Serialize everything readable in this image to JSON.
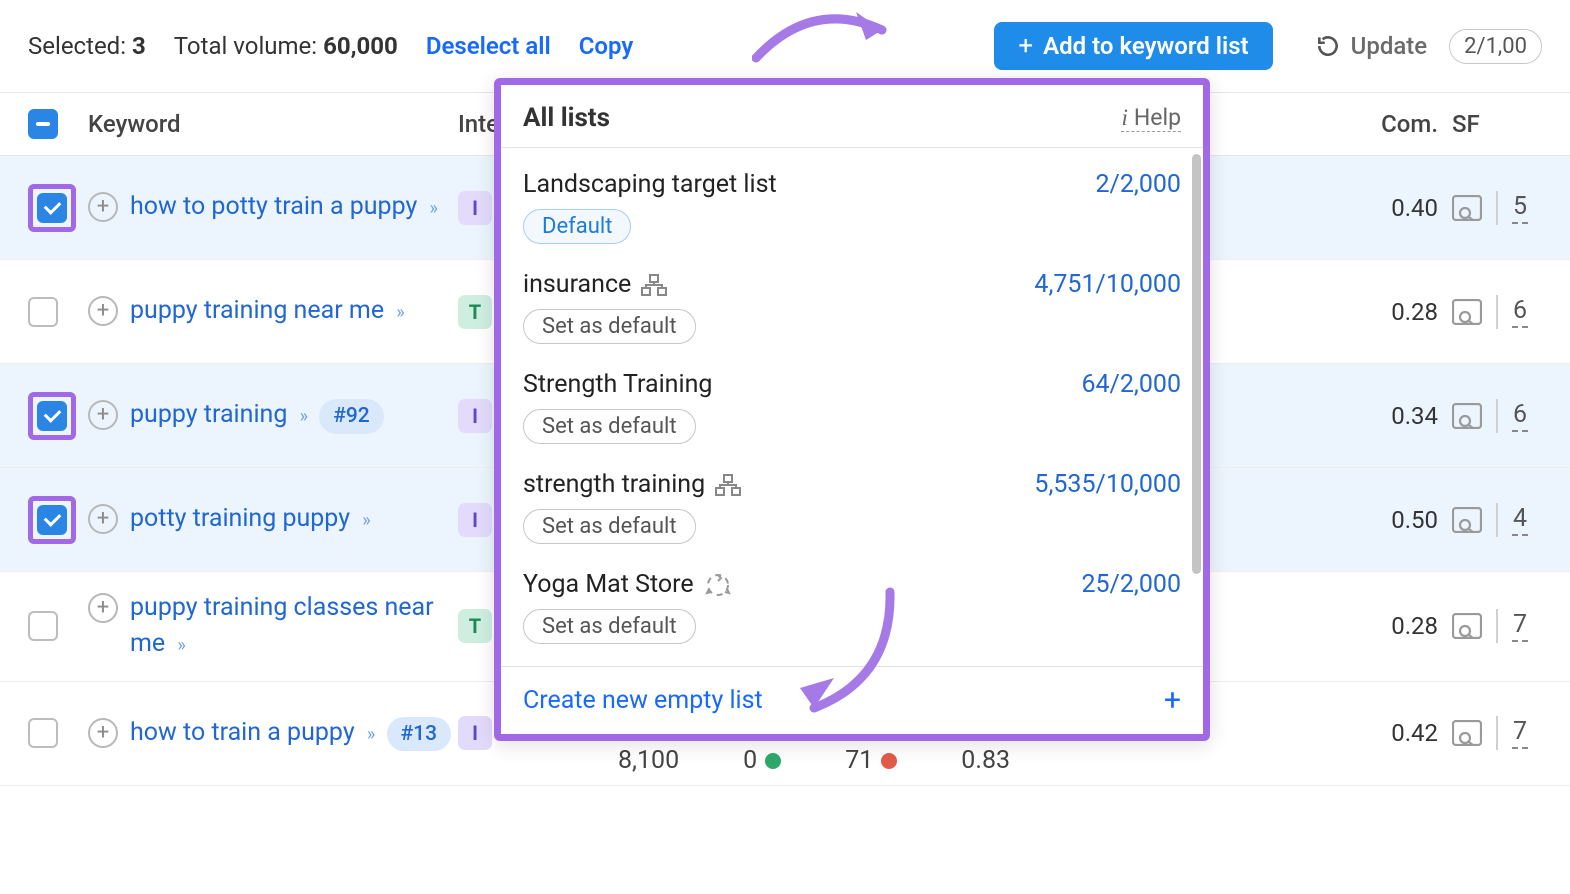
{
  "toolbar": {
    "selected_label": "Selected:",
    "selected_count": "3",
    "total_volume_label": "Total volume:",
    "total_volume": "60,000",
    "deselect": "Deselect all",
    "copy": "Copy",
    "add_to_list": "Add to keyword list",
    "update": "Update",
    "update_count": "2/1,00"
  },
  "headers": {
    "keyword": "Keyword",
    "intent": "Inte",
    "com": "Com.",
    "sf": "SF"
  },
  "rows": [
    {
      "checked": true,
      "hl": true,
      "text": "how to potty train a puppy",
      "rank": "",
      "intent": "I",
      "com": "0.40",
      "sf": "5"
    },
    {
      "checked": false,
      "hl": false,
      "text": "puppy training near me",
      "rank": "",
      "intent": "T",
      "com": "0.28",
      "sf": "6"
    },
    {
      "checked": true,
      "hl": true,
      "text": "puppy training",
      "rank": "#92",
      "intent": "I",
      "com": "0.34",
      "sf": "6"
    },
    {
      "checked": true,
      "hl": true,
      "text": "potty training puppy",
      "rank": "",
      "intent": "I",
      "com": "0.50",
      "sf": "4"
    },
    {
      "checked": false,
      "hl": false,
      "text": "puppy training classes near me",
      "rank": "",
      "intent": "T",
      "com": "0.28",
      "sf": "7"
    },
    {
      "checked": false,
      "hl": false,
      "text": "how to train a puppy",
      "rank": "#13",
      "intent": "I",
      "com": "0.42",
      "sf": "7"
    }
  ],
  "under_row": {
    "vol": "8,100",
    "cpc": "0",
    "kd": "71",
    "trend": "0.83"
  },
  "popup": {
    "title": "All lists",
    "help": "Help",
    "items": [
      {
        "name": "Landscaping target list",
        "count": "2/2,000",
        "default": true,
        "icon": ""
      },
      {
        "name": "insurance",
        "count": "4,751/10,000",
        "default": false,
        "icon": "sitemap"
      },
      {
        "name": "Strength Training",
        "count": "64/2,000",
        "default": false,
        "icon": ""
      },
      {
        "name": "strength training",
        "count": "5,535/10,000",
        "default": false,
        "icon": "sitemap"
      },
      {
        "name": "Yoga Mat Store",
        "count": "25/2,000",
        "default": false,
        "icon": "recycle"
      }
    ],
    "default_chip": "Default",
    "set_default_chip": "Set as default",
    "create": "Create new empty list"
  }
}
